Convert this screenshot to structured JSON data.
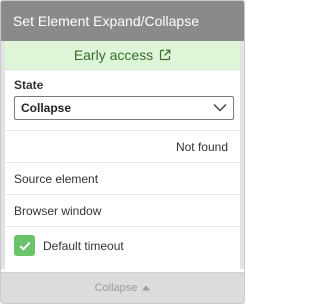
{
  "header": {
    "title": "Set Element Expand/Collapse"
  },
  "banner": {
    "label": "Early access",
    "icon": "external-link-icon",
    "color": "#dff5d8"
  },
  "state": {
    "label": "State",
    "selected": "Collapse",
    "icon": "chevron-down-icon"
  },
  "status": {
    "text": "Not found"
  },
  "fields": [
    {
      "label": "Source element"
    },
    {
      "label": "Browser window"
    }
  ],
  "timeout": {
    "label": "Default timeout",
    "checked": true,
    "color": "#6ac36a"
  },
  "footer": {
    "label": "Collapse",
    "icon": "caret-up-icon"
  }
}
